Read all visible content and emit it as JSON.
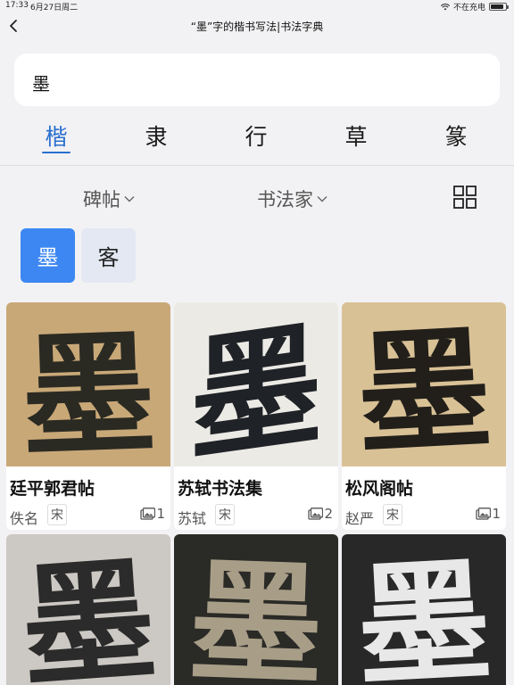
{
  "status_bar": {
    "time": "17:33",
    "date": "6月27日周二",
    "network": "不在充电",
    "battery_level": 0.9
  },
  "nav": {
    "title": "“墨”字的楷书写法|书法字典"
  },
  "search": {
    "value": "墨"
  },
  "script_tabs": [
    {
      "label": "楷",
      "active": true
    },
    {
      "label": "隶",
      "active": false
    },
    {
      "label": "行",
      "active": false
    },
    {
      "label": "草",
      "active": false
    },
    {
      "label": "篆",
      "active": false
    }
  ],
  "filters": {
    "stele": "碑帖",
    "calligrapher": "书法家"
  },
  "chips": [
    {
      "label": "墨",
      "active": true
    },
    {
      "label": "客",
      "active": false
    }
  ],
  "cards": [
    {
      "title": "廷平郭君帖",
      "author": "佚名",
      "dynasty": "宋",
      "count": "1",
      "glyph": "墨",
      "bg": "#c9a878",
      "ink": "#2a2a22"
    },
    {
      "title": "苏轼书法集",
      "author": "苏轼",
      "dynasty": "宋",
      "count": "2",
      "glyph": "墨",
      "bg": "#eceae5",
      "ink": "#1f2226"
    },
    {
      "title": "松风阁帖",
      "author": "赵严",
      "dynasty": "宋",
      "count": "1",
      "glyph": "墨",
      "bg": "#d9c196",
      "ink": "#221f1a"
    },
    {
      "glyph": "墨",
      "bg": "#ccc8c3",
      "ink": "#2b2b2b"
    },
    {
      "glyph": "墨",
      "bg": "#2a2a26",
      "ink": "#a89e88"
    },
    {
      "glyph": "墨",
      "bg": "#282828",
      "ink": "#e8e8e8"
    }
  ]
}
